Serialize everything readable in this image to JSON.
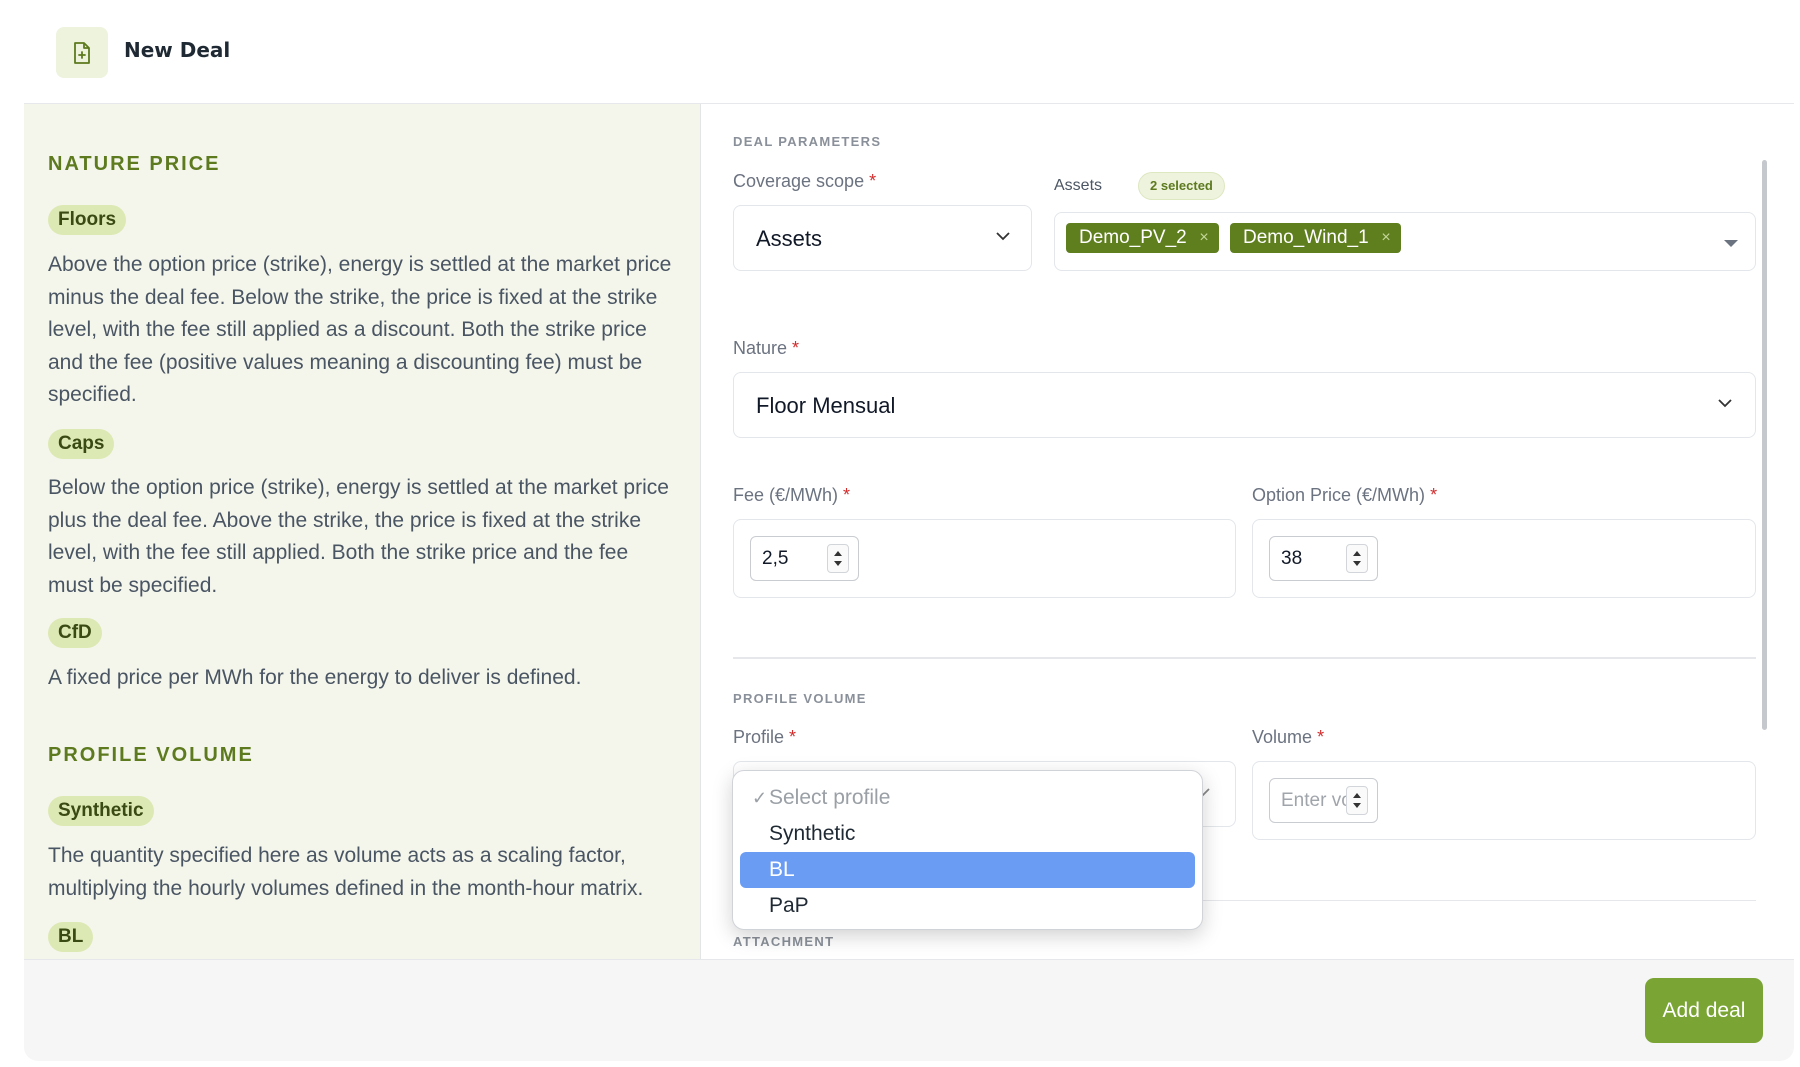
{
  "header": {
    "title": "New Deal",
    "icon": "file-plus-icon"
  },
  "help": {
    "nature_section_title": "NATURE PRICE",
    "floors_tag": "Floors",
    "floors_text": "Above the option price (strike), energy is settled at the market price minus the deal fee. Below the strike, the price is fixed at the strike level, with the fee still applied as a discount. Both the strike price and the fee (positive values meaning a discounting fee) must be specified.",
    "caps_tag": "Caps",
    "caps_text": "Below the option price (strike), energy is settled at the market price plus the deal fee. Above the strike, the price is fixed at the strike level, with the fee still applied. Both the strike price and the fee must be specified.",
    "cfd_tag": "CfD",
    "cfd_text": "A fixed price per MWh for the energy to deliver is defined.",
    "profile_section_title": "PROFILE VOLUME",
    "synthetic_tag": "Synthetic",
    "synthetic_text": "The quantity specified here as volume acts as a scaling factor, multiplying the hourly volumes defined in the month-hour matrix.",
    "bl_tag": "BL"
  },
  "form": {
    "deal_params_title": "DEAL PARAMETERS",
    "coverage_label": "Coverage scope",
    "coverage_value": "Assets",
    "assets_label": "Assets",
    "assets_badge": "2 selected",
    "asset_chips": [
      "Demo_PV_2",
      "Demo_Wind_1"
    ],
    "chip_remove": "×",
    "nature_label": "Nature",
    "nature_value": "Floor Mensual",
    "fee_label": "Fee (€/MWh)",
    "fee_value": "2,5",
    "option_label": "Option Price (€/MWh)",
    "option_value": "38",
    "profile_volume_title": "PROFILE VOLUME",
    "profile_label": "Profile",
    "volume_label": "Volume",
    "volume_placeholder": "Enter volume",
    "attachment_title": "ATTACHMENT",
    "required_mark": "*"
  },
  "profile_dropdown": {
    "check": "✓",
    "options": [
      "Select profile",
      "Synthetic",
      "BL",
      "PaP"
    ],
    "highlighted": "BL"
  },
  "footer": {
    "add_button": "Add deal"
  },
  "colors": {
    "accent": "#7aa534",
    "chip": "#5f7f1f",
    "tag": "#dde9b4",
    "section_title": "#5d7a1f",
    "selection": "#6b9cf4"
  }
}
